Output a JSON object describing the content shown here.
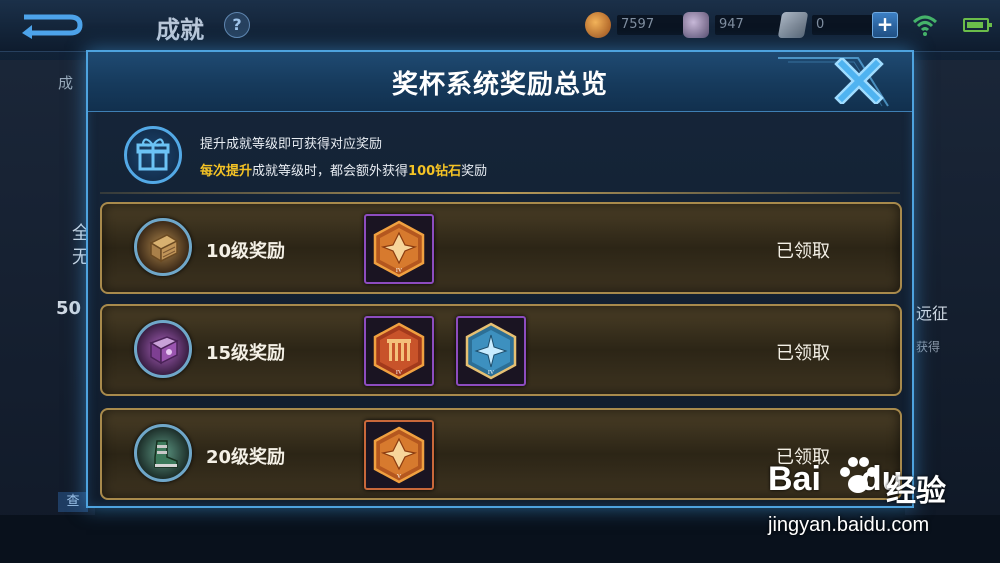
{
  "topbar": {
    "title": "成就",
    "help": "?",
    "currencies": [
      {
        "name": "gold-coin-icon",
        "value": "7597"
      },
      {
        "name": "gem-icon",
        "value": "947"
      },
      {
        "name": "ticket-icon",
        "value": "0"
      }
    ],
    "plus": "+"
  },
  "background": {
    "left_text_1": "成",
    "left_text_2": "全",
    "left_text_2b": "无",
    "left_text_3": "50",
    "left_button": "查",
    "right_text_1": "远征",
    "right_text_2": "获得"
  },
  "dialog": {
    "title": "奖杯系统奖励总览",
    "intro_line1": "提升成就等级即可获得对应奖励",
    "intro_line2_hl1": "每次提升",
    "intro_line2_mid": "成就等级时，都会额外获得",
    "intro_line2_hl2": "100钻石",
    "intro_line2_end": "奖励",
    "rows": [
      {
        "label": "10级奖励",
        "status": "已领取",
        "icon": "wooden-chest-icon",
        "items": [
          "orange-crest-iv-emblem"
        ]
      },
      {
        "label": "15级奖励",
        "status": "已领取",
        "icon": "purple-book-icon",
        "items": [
          "red-pillar-iv-emblem",
          "blue-star-iv-emblem"
        ]
      },
      {
        "label": "20级奖励",
        "status": "已领取",
        "icon": "green-boots-icon",
        "items": [
          "orange-crest-v-emblem"
        ]
      }
    ]
  },
  "watermark": {
    "logo": "Bai",
    "logo2": "du",
    "cn": "经验",
    "url": "jingyan.baidu.com"
  },
  "colors": {
    "accent_blue": "#4ea3df",
    "gold_highlight": "#f4c325",
    "row_border": "#a88a4c"
  }
}
